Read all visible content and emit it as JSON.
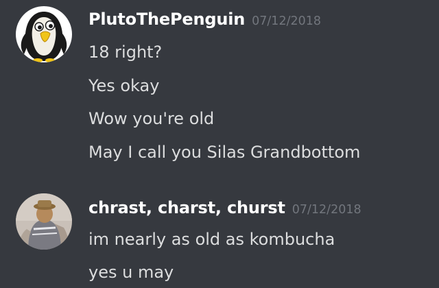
{
  "messages": [
    {
      "username": "PlutoThePenguin",
      "timestamp": "07/12/2018",
      "avatar": "penguin-avatar",
      "lines": [
        "18 right?",
        "Yes okay",
        "Wow you're old",
        "May I call you Silas Grandbottom"
      ]
    },
    {
      "username": "chrast, charst, churst",
      "timestamp": "07/12/2018",
      "avatar": "photo-avatar",
      "lines": [
        "im nearly as old as kombucha",
        "yes u may"
      ]
    }
  ],
  "colors": {
    "background": "#36393f",
    "username": "#ffffff",
    "message_text": "#dcddde",
    "timestamp": "#72767d"
  }
}
